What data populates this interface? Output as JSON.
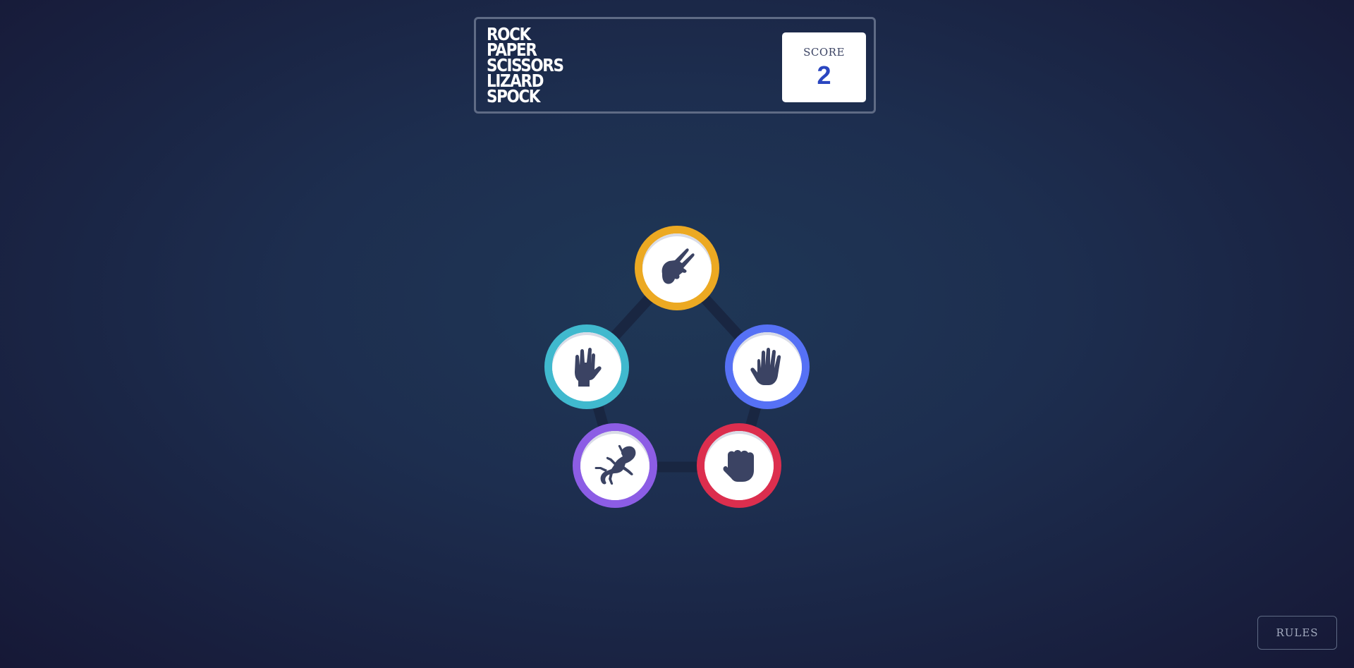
{
  "header": {
    "logo_lines": [
      "ROCK",
      "PAPER",
      "SCISSORS",
      "LIZARD",
      "SPOCK"
    ],
    "score_label": "SCORE",
    "score_value": "2"
  },
  "board": {
    "choices": [
      {
        "id": "scissors",
        "icon": "scissors-icon",
        "color": "#eca922"
      },
      {
        "id": "paper",
        "icon": "paper-icon",
        "color": "#5671f5"
      },
      {
        "id": "rock",
        "icon": "rock-icon",
        "color": "#dc2e4e"
      },
      {
        "id": "lizard",
        "icon": "lizard-icon",
        "color": "#8c5de5"
      },
      {
        "id": "spock",
        "icon": "spock-icon",
        "color": "#40b9ce"
      }
    ]
  },
  "footer": {
    "rules_label": "RULES"
  }
}
